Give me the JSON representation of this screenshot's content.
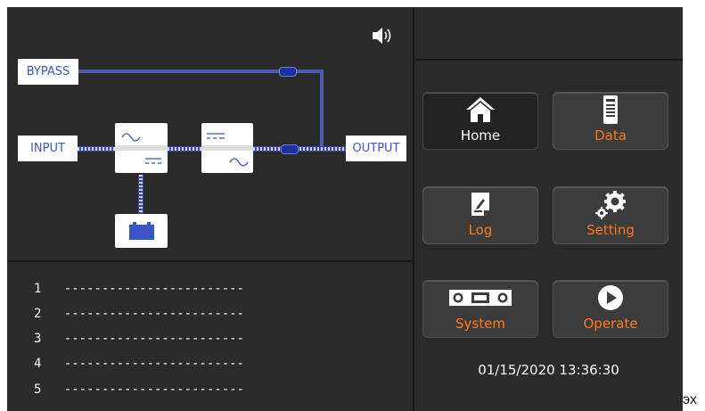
{
  "diagram": {
    "bypass_label": "BYPASS",
    "input_label": "INPUT",
    "output_label": "OUTPUT",
    "line_color": "#4a5bb0"
  },
  "log_list": [
    {
      "num": "1",
      "text": "------------------------"
    },
    {
      "num": "2",
      "text": "------------------------"
    },
    {
      "num": "3",
      "text": "------------------------"
    },
    {
      "num": "4",
      "text": "------------------------"
    },
    {
      "num": "5",
      "text": "------------------------"
    }
  ],
  "nav": {
    "home": "Home",
    "data": "Data",
    "log": "Log",
    "setting": "Setting",
    "system": "System",
    "operate": "Operate"
  },
  "colors": {
    "accent": "#ff7a1a",
    "panel": "#2b2b2b"
  },
  "datetime": "01/15/2020  13:36:30",
  "outside_text": "эх"
}
